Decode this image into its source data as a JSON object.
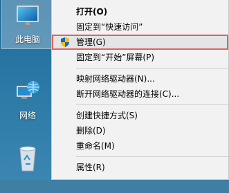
{
  "desktop": {
    "icons": [
      {
        "label": "此电脑",
        "icon": "computer-icon",
        "selected": true
      },
      {
        "label": "网络",
        "icon": "network-icon",
        "selected": false
      },
      {
        "label": "",
        "icon": "recycle-bin-icon",
        "selected": false
      }
    ]
  },
  "context_menu": {
    "items": [
      {
        "label": "打开(O)",
        "bold": true
      },
      {
        "label": "固定到“快速访问”"
      },
      {
        "label": "管理(G)",
        "icon": "shield-icon",
        "highlighted": true
      },
      {
        "label": "固定到“开始”屏幕(P)"
      },
      {
        "label": "映射网络驱动器(N)..."
      },
      {
        "label": "断开网络驱动器的连接(C)..."
      },
      {
        "label": "创建快捷方式(S)"
      },
      {
        "label": "删除(D)"
      },
      {
        "label": "重命名(M)"
      },
      {
        "label": "属性(R)"
      }
    ],
    "highlight_color": "#e06063"
  }
}
